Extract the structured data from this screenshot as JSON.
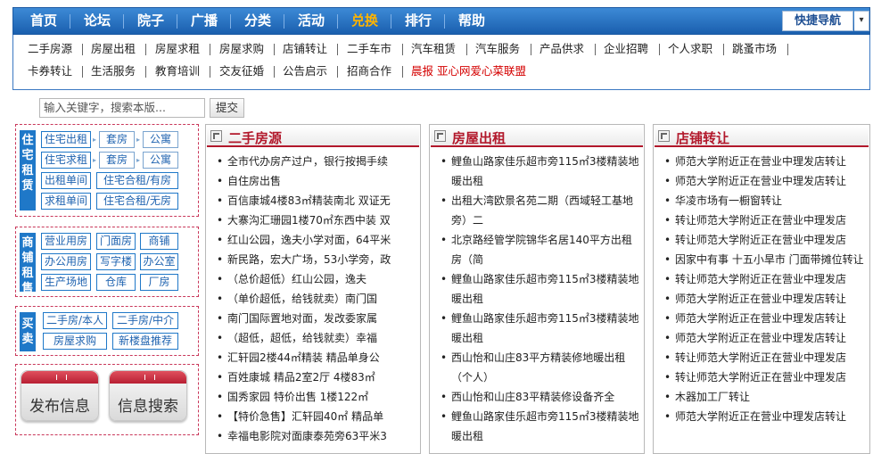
{
  "topnav": {
    "items": [
      "首页",
      "论坛",
      "院子",
      "广播",
      "分类",
      "活动",
      "兑换",
      "排行",
      "帮助"
    ],
    "active_index": 6,
    "quick_nav": "快捷导航",
    "dropdown_glyph": "▾"
  },
  "subnav": {
    "row1": [
      "二手房源",
      "房屋出租",
      "房屋求租",
      "房屋求购",
      "店铺转让",
      "二手车市",
      "汽车租赁",
      "汽车服务",
      "产品供求",
      "企业招聘",
      "个人求职",
      "跳蚤市场"
    ],
    "row2": [
      "卡券转让",
      "生活服务",
      "教育培训",
      "交友征婚",
      "公告启示",
      "招商合作",
      "晨报 亚心网爱心菜联盟"
    ]
  },
  "search": {
    "placeholder": "输入关键字，搜索本版...",
    "button": "提交"
  },
  "categories": {
    "housing": {
      "side": "住宅租赁",
      "buttons": [
        "住宅出租",
        "套房",
        "公寓",
        "住宅求租",
        "套房",
        "公寓",
        "出租单间",
        "住宅合租/有房",
        "求租单间",
        "住宅合租/无房"
      ]
    },
    "commercial": {
      "side": "商铺租售",
      "buttons": [
        "营业用房",
        "门面房",
        "商铺",
        "办公用房",
        "写字楼",
        "办公室",
        "生产场地",
        "仓库",
        "厂房"
      ]
    },
    "trade": {
      "side": "买卖",
      "buttons": [
        "二手房/本人",
        "二手房/中介",
        "房屋求购",
        "新楼盘推荐"
      ]
    },
    "publish_label": "发布信息",
    "search_label": "信息搜索"
  },
  "panels": [
    {
      "title": "二手房源",
      "items": [
        "全市代办房产过户，银行按揭手续",
        "自住房出售",
        "百信康城4楼83㎡精装南北 双证无",
        "大寨沟汇珊园1楼70㎡东西中装 双",
        "红山公园，逸夫小学对面，64平米",
        "新民路，宏大广场，53小学旁，政",
        "（总价超低）红山公园，逸夫",
        "（单价超低，给钱就卖）南门国",
        "南门国际置地对面，发改委家属",
        "（超低，超低，给钱就卖）幸福",
        "汇轩园2楼44㎡精装 精品单身公",
        "百姓康城 精品2室2厅 4楼83㎡",
        "国秀家园 特价出售 1楼122㎡",
        "【特价急售】汇轩园40㎡ 精品单",
        "幸福电影院对面康泰苑旁63平米3"
      ]
    },
    {
      "title": "房屋出租",
      "items": [
        "鲤鱼山路家佳乐超市旁115㎡3楼精装地暖出租",
        "出租大湾欧景名苑二期（西域轻工基地旁）二",
        "北京路经管学院锦华名居140平方出租房（简",
        "鲤鱼山路家佳乐超市旁115㎡3楼精装地暖出租",
        "鲤鱼山路家佳乐超市旁115㎡3楼精装地暖出租",
        "西山怡和山庄83平方精装修地暖出租（个人）",
        "西山怡和山庄83平精装修设备齐全",
        "鲤鱼山路家佳乐超市旁115㎡3楼精装地暖出租"
      ]
    },
    {
      "title": "店铺转让",
      "items": [
        "师范大学附近正在营业中理发店转让",
        "师范大学附近正在营业中理发店转让",
        "华凌市场有一橱窗转让",
        "转让师范大学附近正在营业中理发店",
        "转让师范大学附近正在营业中理发店",
        "因家中有事 十五小旱市 门面带摊位转让",
        "转让师范大学附近正在营业中理发店",
        "师范大学附近正在营业中理发店转让",
        "师范大学附近正在营业中理发店转让",
        "师范大学附近正在营业中理发店转让",
        "转让师范大学附近正在营业中理发店",
        "转让师范大学附近正在营业中理发店",
        "木器加工厂转让",
        "师范大学附近正在营业中理发店转让"
      ]
    }
  ],
  "colors": {
    "nav_blue": "#1a5fae",
    "accent_red": "#b2182b",
    "active_orange": "#ffb400",
    "link_blue": "#1f63b0"
  }
}
